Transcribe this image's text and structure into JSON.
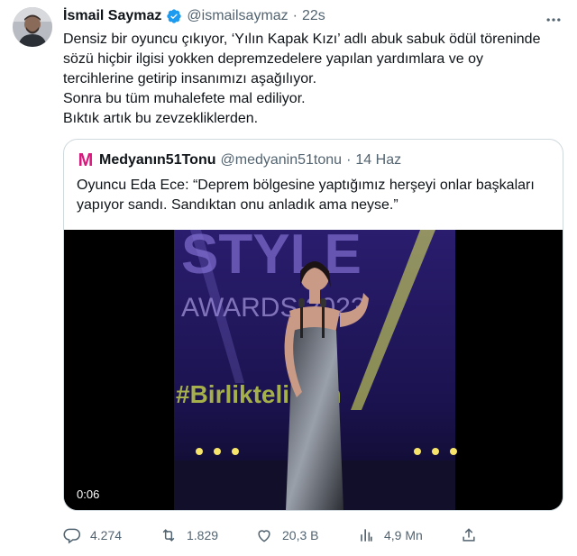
{
  "tweet": {
    "author_name": "İsmail Saymaz",
    "handle": "@ismailsaymaz",
    "separator": "·",
    "time": "22s",
    "lines": [
      "Densiz bir oyuncu çıkıyor, ‘Yılın Kapak Kızı’ adlı abuk sabuk ödül töreninde",
      "sözü hiçbir ilgisi yokken depremzedelere yapılan yardımlara ve oy",
      "tercihlerine getirip insanımızı aşağılıyor.",
      "Sonra bu tüm muhalefete mal ediliyor.",
      "Bıktık artık bu zevzekliklerden."
    ]
  },
  "quote": {
    "avatar_letter": "M",
    "author_name": "Medyanın51Tonu",
    "handle": "@medyanin51tonu",
    "separator": "·",
    "time": "14 Haz",
    "lines": [
      "Oyuncu Eda Ece: “Deprem bölgesine yaptığımız herşeyi onlar başkaları",
      "yapıyor sandı. Sandıktan onu anladık ama neyse.”"
    ],
    "video": {
      "backdrop_text": [
        "STYLE",
        "AWARDS 2023",
        "#Birliktelikten"
      ],
      "duration": "0:06"
    }
  },
  "actions": {
    "replies": "4.274",
    "retweets": "1.829",
    "likes": "20,3 B",
    "views": "4,9 Mn"
  },
  "colors": {
    "verified": "#1d9bf0",
    "secondary_text": "#536471",
    "border": "#cfd9de",
    "quote_brand": "#d6197c"
  }
}
